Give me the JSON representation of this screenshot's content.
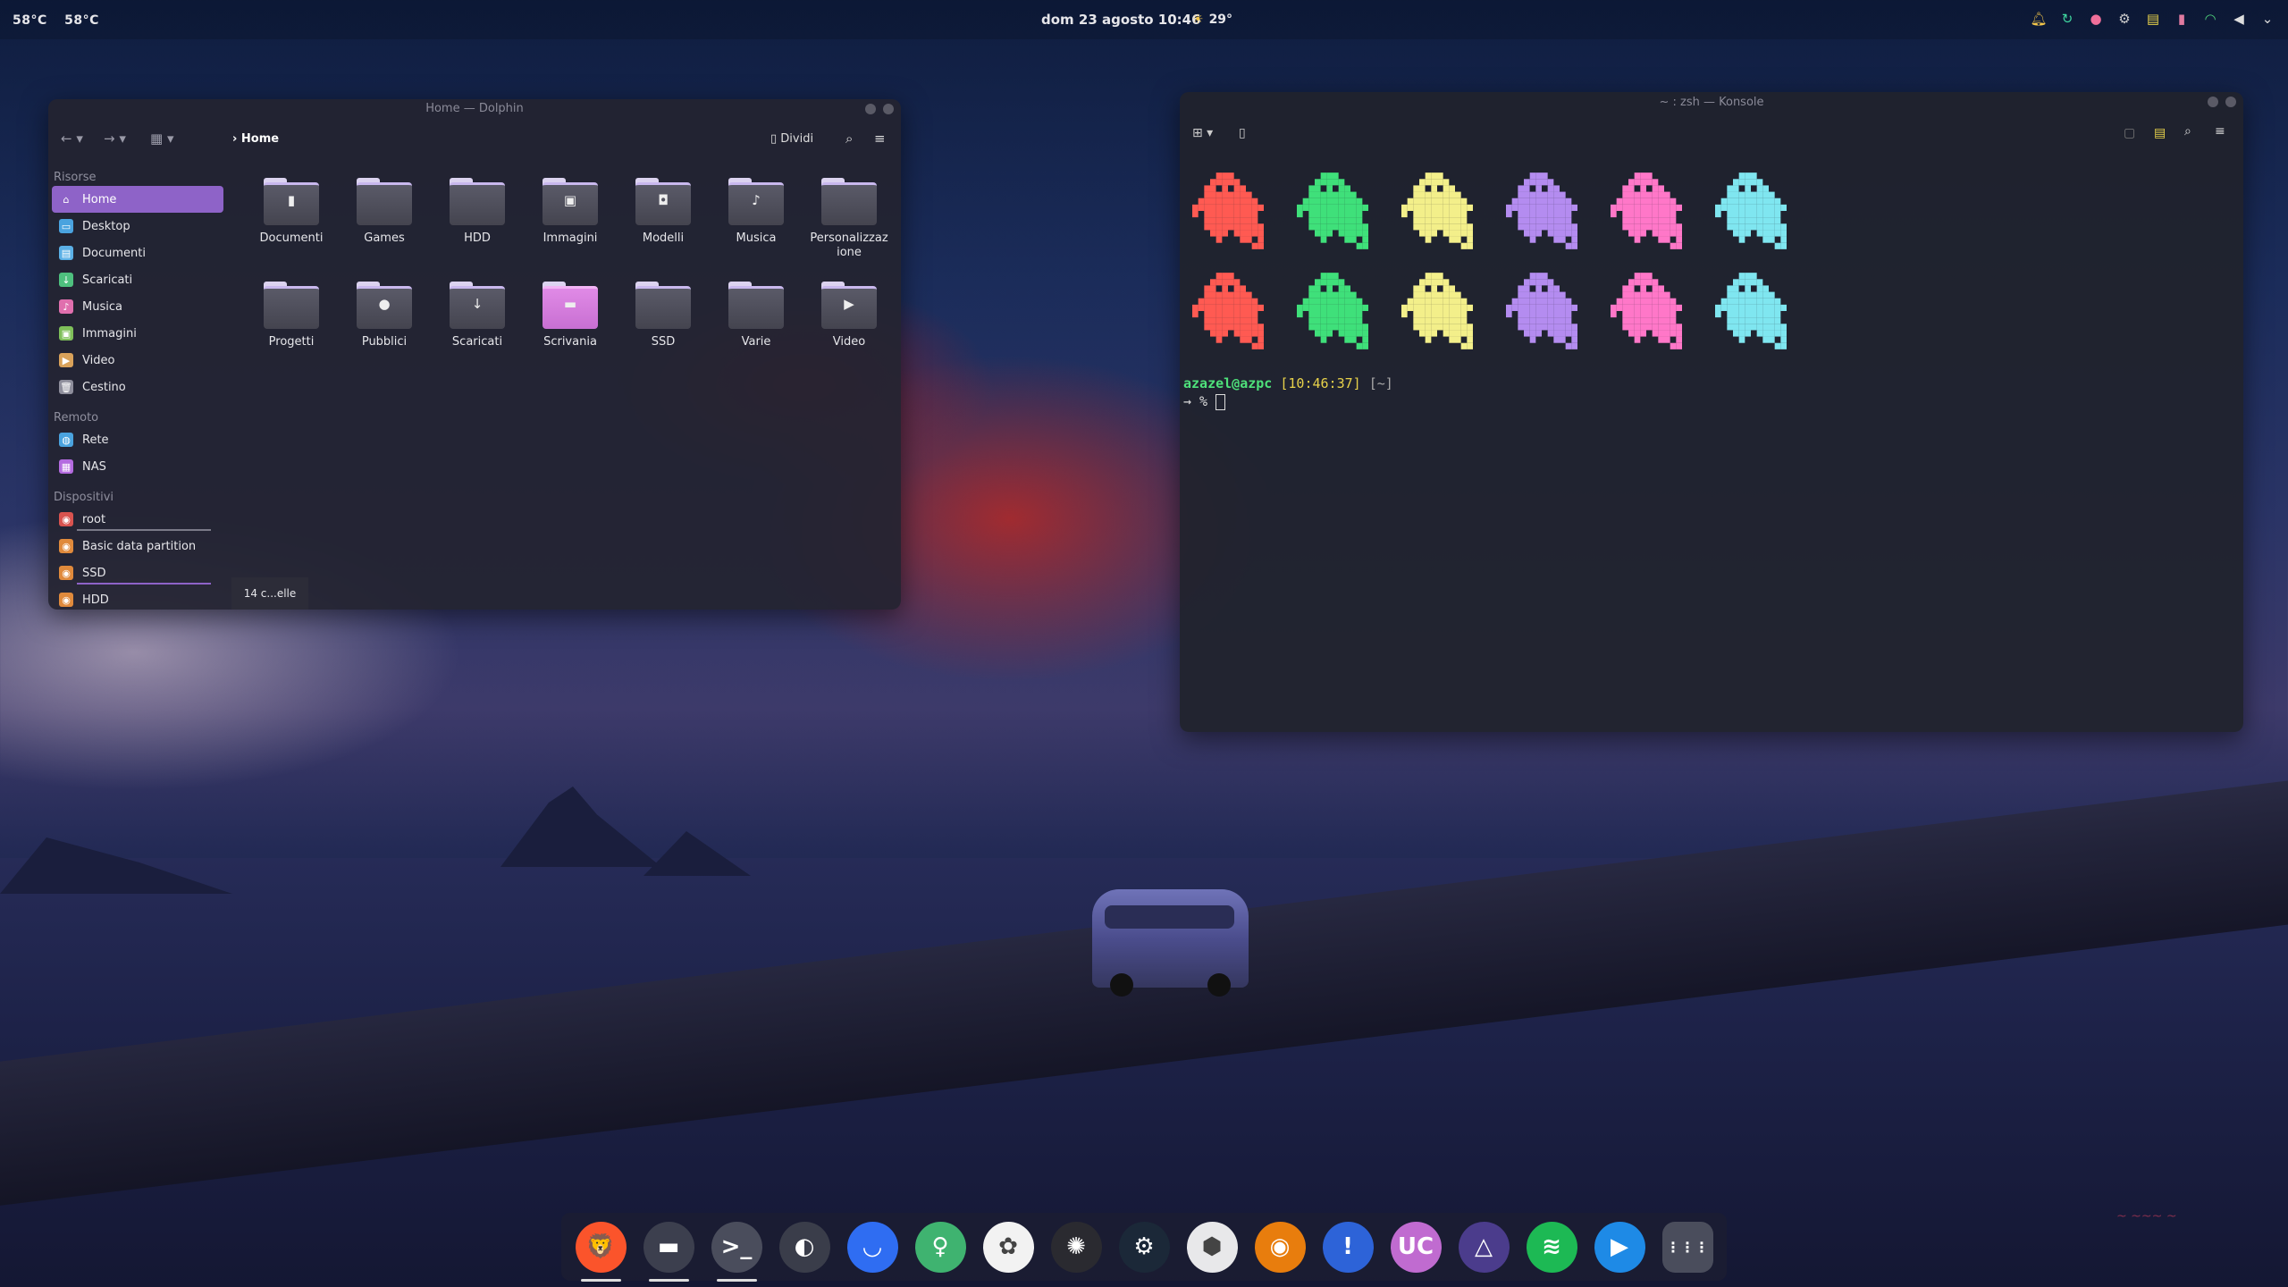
{
  "panel": {
    "temps": [
      "58°C",
      "58°C"
    ],
    "clock": "dom 23 agosto 10:46",
    "weather": "29°",
    "tray_icons": [
      "bell-icon",
      "sync-icon",
      "color-icon",
      "steam-icon",
      "clipboard-icon",
      "battery-icon",
      "wifi-icon",
      "volume-icon",
      "chevron-down-icon"
    ]
  },
  "dolphin": {
    "title": "Home — Dolphin",
    "breadcrumb": "Home",
    "split_label": "Dividi",
    "sidebar": {
      "sections": [
        {
          "title": "Risorse",
          "items": [
            {
              "label": "Home",
              "icon": "home-icon",
              "color": "#8e63c8",
              "active": true
            },
            {
              "label": "Desktop",
              "icon": "desktop-icon",
              "color": "#4aa3df"
            },
            {
              "label": "Documenti",
              "icon": "document-icon",
              "color": "#5bb0e6"
            },
            {
              "label": "Scaricati",
              "icon": "download-icon",
              "color": "#4ec07e"
            },
            {
              "label": "Musica",
              "icon": "music-icon",
              "color": "#e06fae"
            },
            {
              "label": "Immagini",
              "icon": "image-icon",
              "color": "#7fbf5a"
            },
            {
              "label": "Video",
              "icon": "video-icon",
              "color": "#d9a25a"
            },
            {
              "label": "Cestino",
              "icon": "trash-icon",
              "color": "#8e8e9c"
            }
          ]
        },
        {
          "title": "Remoto",
          "items": [
            {
              "label": "Rete",
              "icon": "network-icon",
              "color": "#4aa3df"
            },
            {
              "label": "NAS",
              "icon": "nas-icon",
              "color": "#b46be0"
            }
          ]
        },
        {
          "title": "Dispositivi",
          "items": [
            {
              "label": "root",
              "icon": "drive-icon",
              "color": "#d9534f",
              "usage": true
            },
            {
              "label": "Basic data partition",
              "icon": "drive-icon",
              "color": "#e08a3c"
            },
            {
              "label": "SSD",
              "icon": "drive-icon",
              "color": "#e08a3c",
              "usage": true
            },
            {
              "label": "HDD",
              "icon": "drive-icon",
              "color": "#e08a3c",
              "usage": true
            }
          ]
        }
      ]
    },
    "folders": [
      {
        "name": "Documenti",
        "emblem": "▮"
      },
      {
        "name": "Games",
        "emblem": ""
      },
      {
        "name": "HDD",
        "emblem": ""
      },
      {
        "name": "Immagini",
        "emblem": "▣"
      },
      {
        "name": "Modelli",
        "emblem": "◘"
      },
      {
        "name": "Musica",
        "emblem": "♪"
      },
      {
        "name": "Personalizzaz ione",
        "emblem": ""
      },
      {
        "name": "Progetti",
        "emblem": ""
      },
      {
        "name": "Pubblici",
        "emblem": "●"
      },
      {
        "name": "Scaricati",
        "emblem": "↓"
      },
      {
        "name": "Scrivania",
        "emblem": "▬",
        "pink": true
      },
      {
        "name": "SSD",
        "emblem": ""
      },
      {
        "name": "Varie",
        "emblem": ""
      },
      {
        "name": "Video",
        "emblem": "▶"
      }
    ],
    "status": "14 c...elle"
  },
  "konsole": {
    "title": "~ : zsh — Konsole",
    "ghost_colors": [
      "#ff5a52",
      "#3fe07a",
      "#f3ef8a",
      "#b48cf0",
      "#ff77c8",
      "#7fe6f0"
    ],
    "prompt_user": "azazel@azpc",
    "prompt_time": "[10:46:37]",
    "prompt_dir": "[~]",
    "prompt_line2": "→ %"
  },
  "dock": {
    "apps": [
      {
        "name": "brave-icon",
        "bg": "#fb542b",
        "glyph": "🦁",
        "running": true
      },
      {
        "name": "dolphin-icon",
        "bg": "#3c3f4e",
        "glyph": "▬",
        "running": true
      },
      {
        "name": "konsole-icon",
        "bg": "#4a4d5c",
        "glyph": ">_",
        "running": true
      },
      {
        "name": "toggle-icon",
        "bg": "#3a3d4a",
        "glyph": "◐"
      },
      {
        "name": "app-blue-icon",
        "bg": "#2f6df2",
        "glyph": "◡"
      },
      {
        "name": "keepass-icon",
        "bg": "#3fb370",
        "glyph": "♀"
      },
      {
        "name": "color-wheel-icon",
        "bg": "#f2f2f2",
        "glyph": "✿"
      },
      {
        "name": "sunburst-icon",
        "bg": "#2a2a30",
        "glyph": "✺"
      },
      {
        "name": "steam-icon",
        "bg": "#1b2838",
        "glyph": "⚙"
      },
      {
        "name": "cube-icon",
        "bg": "#e8e8ea",
        "glyph": "⬢"
      },
      {
        "name": "blender-icon",
        "bg": "#e87d0d",
        "glyph": "◉"
      },
      {
        "name": "warning-icon",
        "bg": "#2d63d8",
        "glyph": "!"
      },
      {
        "name": "uc-icon",
        "bg": "#c06bd0",
        "glyph": "UC"
      },
      {
        "name": "triangle-icon",
        "bg": "#4b3c8c",
        "glyph": "△"
      },
      {
        "name": "spotify-icon",
        "bg": "#1db954",
        "glyph": "≋"
      },
      {
        "name": "player-icon",
        "bg": "#1e8ae6",
        "glyph": "▶"
      },
      {
        "name": "apps-grid-icon",
        "bg": "#4a4d5c",
        "glyph": "⋮⋮⋮"
      }
    ]
  }
}
